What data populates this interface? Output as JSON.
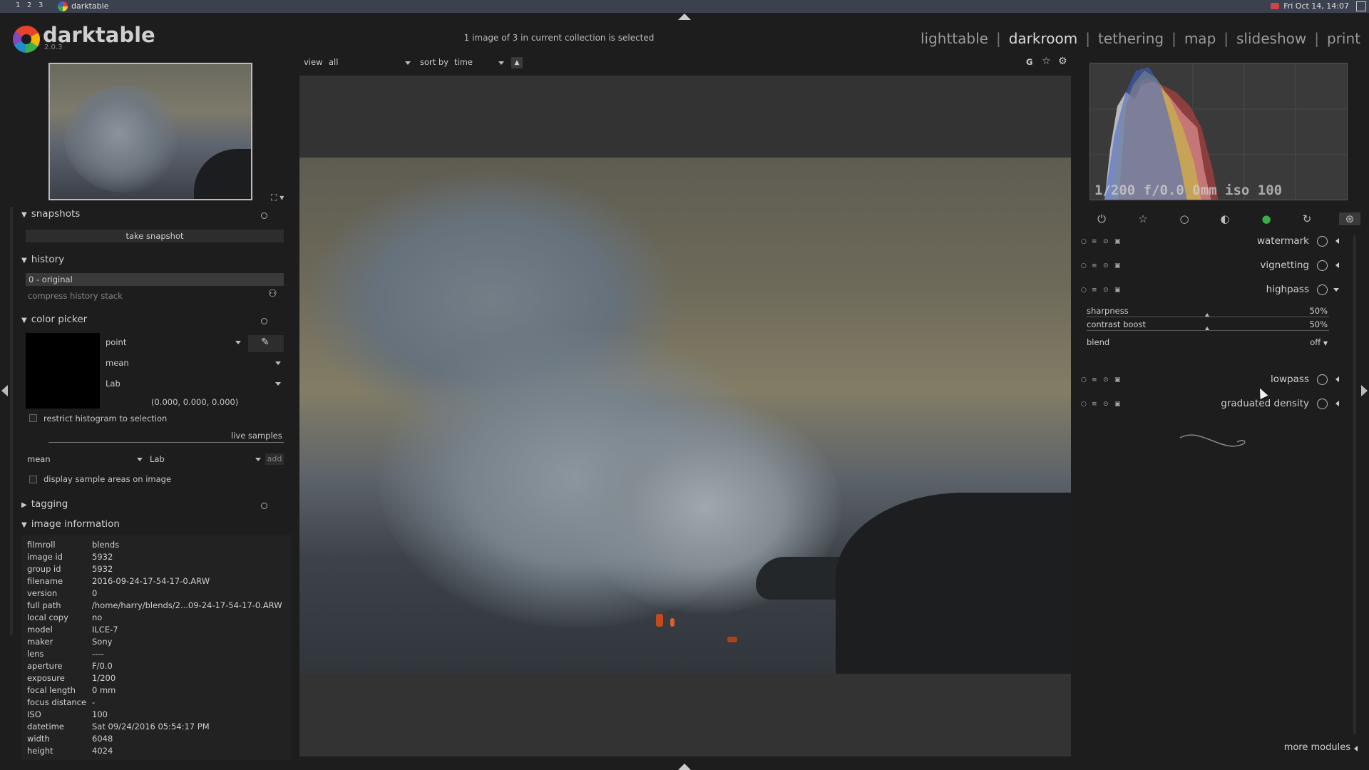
{
  "taskbar": {
    "workspaces": [
      "1",
      "2",
      "3"
    ],
    "app_title": "darktable",
    "clock": "Fri Oct 14, 14:07"
  },
  "header": {
    "app_name": "darktable",
    "version": "2.0.3",
    "collection_message": "1 image of 3 in current collection is selected",
    "views": [
      "lighttable",
      "darkroom",
      "tethering",
      "map",
      "slideshow",
      "print"
    ],
    "active_view": "darkroom"
  },
  "filter_bar": {
    "view_label": "view",
    "view_value": "all",
    "sort_label": "sort by",
    "sort_value": "time",
    "g_label": "G"
  },
  "left_panel": {
    "snapshots": {
      "title": "snapshots",
      "take_snapshot": "take snapshot"
    },
    "history": {
      "title": "history",
      "items": [
        "0 - original"
      ],
      "compress": "compress history stack"
    },
    "color_picker": {
      "title": "color picker",
      "mode": "point",
      "statistic": "mean",
      "colorspace": "Lab",
      "values": "(0.000, 0.000, 0.000)",
      "restrict_label": "restrict histogram to selection",
      "live_samples": "live samples",
      "sample_stat": "mean",
      "sample_space": "Lab",
      "add": "add",
      "display_samples": "display sample areas on image"
    },
    "tagging": {
      "title": "tagging"
    },
    "image_information": {
      "title": "image information",
      "rows": [
        {
          "label": "filmroll",
          "value": "blends"
        },
        {
          "label": "image id",
          "value": "5932"
        },
        {
          "label": "group id",
          "value": "5932"
        },
        {
          "label": "filename",
          "value": "2016-09-24-17-54-17-0.ARW"
        },
        {
          "label": "version",
          "value": "0"
        },
        {
          "label": "full path",
          "value": "/home/harry/blends/2...09-24-17-54-17-0.ARW"
        },
        {
          "label": "local copy",
          "value": "no"
        },
        {
          "label": "model",
          "value": "ILCE-7"
        },
        {
          "label": "maker",
          "value": "Sony"
        },
        {
          "label": "lens",
          "value": "----"
        },
        {
          "label": "aperture",
          "value": "F/0.0"
        },
        {
          "label": "exposure",
          "value": "1/200"
        },
        {
          "label": "focal length",
          "value": "0 mm"
        },
        {
          "label": "focus distance",
          "value": "-"
        },
        {
          "label": "ISO",
          "value": "100"
        },
        {
          "label": "datetime",
          "value": "Sat 09/24/2016 05:54:17 PM"
        },
        {
          "label": "width",
          "value": "6048"
        },
        {
          "label": "height",
          "value": "4024"
        }
      ]
    }
  },
  "right_panel": {
    "histogram_info": "1/200 f/0.0 0mm iso 100",
    "modules": [
      {
        "name": "watermark",
        "expanded": false
      },
      {
        "name": "vignetting",
        "expanded": false
      },
      {
        "name": "highpass",
        "expanded": true
      },
      {
        "name": "lowpass",
        "expanded": false
      },
      {
        "name": "graduated density",
        "expanded": false
      }
    ],
    "highpass": {
      "sharpness_label": "sharpness",
      "sharpness_value": "50%",
      "contrast_label": "contrast boost",
      "contrast_value": "50%",
      "blend_label": "blend",
      "blend_value": "off"
    },
    "more_modules": "more modules"
  },
  "colors": {
    "background": "#1d1d1d",
    "panel": "#222222",
    "center_canvas": "#333333",
    "taskbar": "#3c4150"
  }
}
